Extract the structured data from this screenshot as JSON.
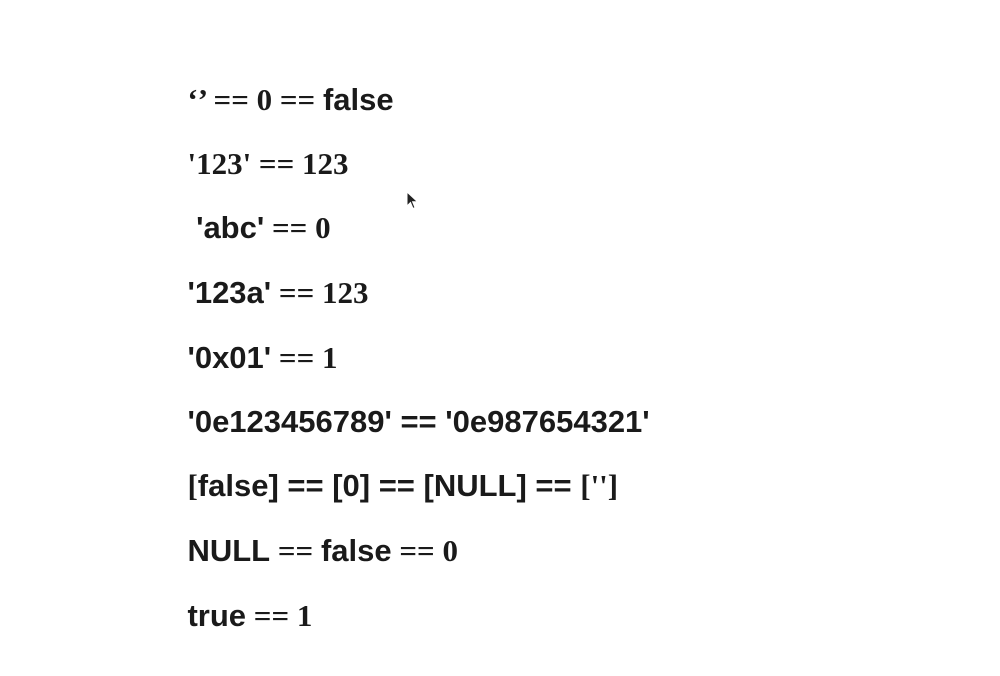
{
  "lines": [
    [
      {
        "text": "‘’ == 0 == ",
        "font": "serif"
      },
      {
        "text": "false",
        "font": "sans"
      }
    ],
    [
      {
        "text": "'123' == 123",
        "font": "serif"
      }
    ],
    [
      {
        "text": " 'abc'",
        "font": "sans"
      },
      {
        "text": " == 0",
        "font": "serif"
      }
    ],
    [
      {
        "text": "'123a'",
        "font": "sans"
      },
      {
        "text": " == 123",
        "font": "serif"
      }
    ],
    [
      {
        "text": "'0x01'",
        "font": "sans"
      },
      {
        "text": " == 1",
        "font": "serif"
      }
    ],
    [
      {
        "text": "'0e123456789' == '0e987654321'",
        "font": "sans"
      }
    ],
    [
      {
        "text": "[",
        "font": "serif"
      },
      {
        "text": "false] == [0] == [NULL] == ",
        "font": "sans"
      },
      {
        "text": "['']",
        "font": "serif"
      }
    ],
    [
      {
        "text": "NULL",
        "font": "sans"
      },
      {
        "text": " == ",
        "font": "serif"
      },
      {
        "text": "false",
        "font": "sans"
      },
      {
        "text": " == 0",
        "font": "serif"
      }
    ],
    [
      {
        "text": "true",
        "font": "sans"
      },
      {
        "text": " == 1",
        "font": "serif"
      }
    ]
  ],
  "icons": {
    "cursor": "mouse-pointer-icon"
  }
}
